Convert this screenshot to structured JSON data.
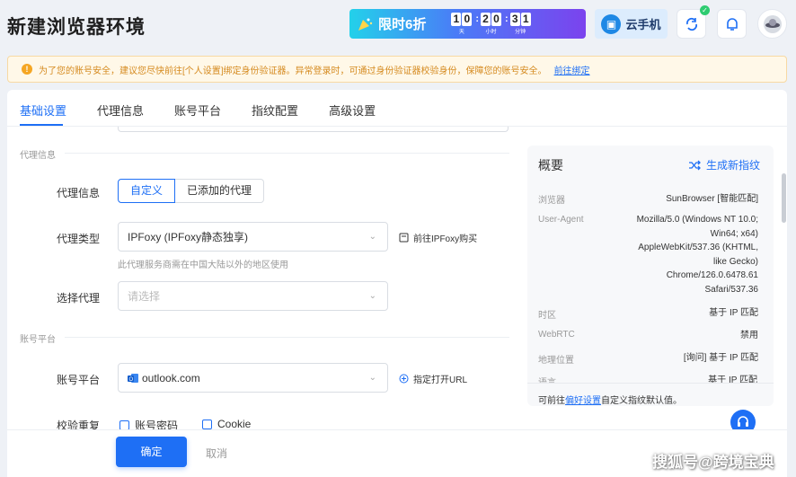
{
  "header": {
    "title": "新建浏览器环境",
    "promo_label": "限时6折",
    "countdown": {
      "days": [
        "1",
        "0"
      ],
      "hours": [
        "2",
        "0"
      ],
      "minutes": [
        "3",
        "1"
      ],
      "unit_days": "天",
      "unit_hours": "小时",
      "unit_minutes": "分钟"
    },
    "cloud_phone_label": "云手机"
  },
  "notice": {
    "text": "为了您的账号安全，建议您尽快前往[个人设置]绑定身份验证器。异常登录时，可通过身份验证器校验身份，保障您的账号安全。",
    "link": "前往绑定"
  },
  "tabs": [
    "基础设置",
    "代理信息",
    "账号平台",
    "指纹配置",
    "高级设置"
  ],
  "proxy_section": {
    "heading": "代理信息",
    "proxy_info_label": "代理信息",
    "mode_custom": "自定义",
    "mode_added": "已添加的代理",
    "proxy_type_label": "代理类型",
    "proxy_type_value": "IPFoxy (IPFoxy静态独享)",
    "buy_link": "前往IPFoxy购买",
    "hint": "此代理服务商需在中国大陆以外的地区使用",
    "select_proxy_label": "选择代理",
    "select_proxy_placeholder": "请选择"
  },
  "account_section": {
    "heading": "账号平台",
    "platform_label": "账号平台",
    "platform_value": "outlook.com",
    "open_url_label": "指定打开URL",
    "verify_label": "校验重复",
    "check_password": "账号密码",
    "check_cookie": "Cookie"
  },
  "summary": {
    "title": "概要",
    "generate_label": "生成新指纹",
    "rows": [
      {
        "k": "浏览器",
        "v": "SunBrowser [智能匹配]"
      },
      {
        "k": "User-Agent",
        "v": "Mozilla/5.0 (Windows NT 10.0; Win64; x64) AppleWebKit/537.36 (KHTML, like Gecko) Chrome/126.0.6478.61 Safari/537.36"
      },
      {
        "k": "时区",
        "v": "基于 IP 匹配"
      },
      {
        "k": "WebRTC",
        "v": "禁用"
      },
      {
        "k": "地理位置",
        "v": "[询问] 基于 IP 匹配"
      },
      {
        "k": "语言",
        "v": "基于 IP 匹配"
      }
    ],
    "foot_prefix": "可前往",
    "foot_link": "偏好设置",
    "foot_suffix": "自定义指纹默认值。"
  },
  "footer": {
    "ok": "确定",
    "cancel": "取消"
  },
  "watermark": "搜狐号@跨境宝典",
  "colors": {
    "primary": "#1e6ff5",
    "warning": "#f5a623"
  }
}
